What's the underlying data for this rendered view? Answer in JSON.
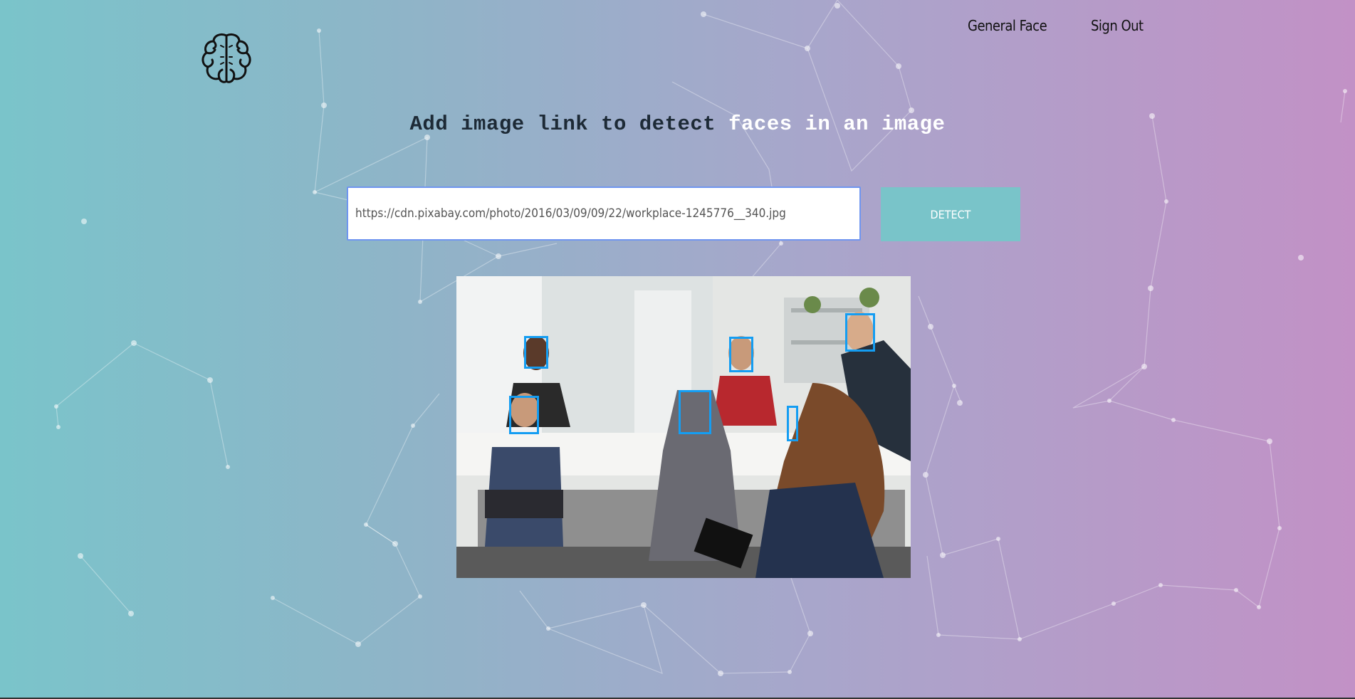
{
  "nav": {
    "general_face": "General Face",
    "sign_out": "Sign Out"
  },
  "logo": {
    "icon": "brain-icon"
  },
  "headline": {
    "part1": "Add image link to detect ",
    "part2": "faces in an image"
  },
  "form": {
    "url_value": "https://cdn.pixabay.com/photo/2016/03/09/09/22/workplace-1245776__340.jpg",
    "detect_label": "DETECT"
  },
  "results": {
    "faces_detected": 6
  },
  "colors": {
    "accent": "#79c4c9",
    "face_box": "#149df2",
    "gradient_left": "#7ac4ca",
    "gradient_right": "#c291c6"
  }
}
